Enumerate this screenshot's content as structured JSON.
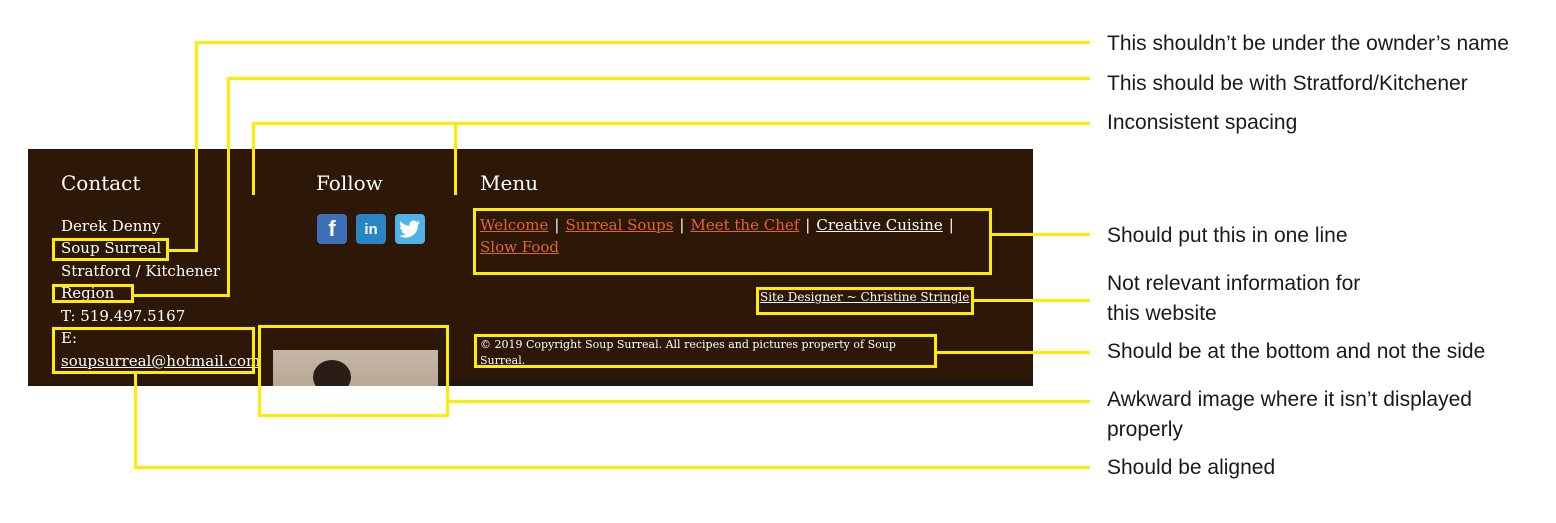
{
  "footer": {
    "contact": {
      "heading": "Contact",
      "name": "Derek Denny",
      "business": "Soup Surreal",
      "city": "Stratford / Kitchener",
      "region": "Region",
      "phone": "T: 519.497.5167",
      "email_label": "E:",
      "email": "soupsurreal@hotmail.com"
    },
    "follow": {
      "heading": "Follow",
      "icons": [
        "facebook-icon",
        "linkedin-icon",
        "twitter-icon"
      ]
    },
    "menu": {
      "heading": "Menu",
      "items": [
        {
          "label": "Welcome",
          "color": "#e0662e"
        },
        {
          "label": "Surreal Soups",
          "color": "#e0662e"
        },
        {
          "label": "Meet the Chef",
          "color": "#e0662e"
        },
        {
          "label": "Creative Cuisine",
          "color": "#ffffff"
        },
        {
          "label": "Slow Food",
          "color": "#e0662e"
        }
      ],
      "separator": "|"
    },
    "designer": "Site Designer ~ Christine Stringle",
    "copyright": "© 2019 Copyright Soup Surreal. All recipes and pictures property of Soup Surreal."
  },
  "annotations": [
    "This shouldn’t be under the ownder’s name",
    "This should be with Stratford/Kitchener",
    "Inconsistent spacing",
    "Should put this in one line",
    "Not relevant information for",
    "this website",
    "Should be at the bottom and not the side",
    "Awkward image where it isn’t displayed",
    "properly",
    "Should be aligned"
  ],
  "colors": {
    "panel": "#2d1706",
    "link": "#e0662e",
    "highlight": "#ffec00",
    "facebook": "#3b6fb6",
    "linkedin": "#2a85c4",
    "twitter": "#4fb3e8"
  }
}
